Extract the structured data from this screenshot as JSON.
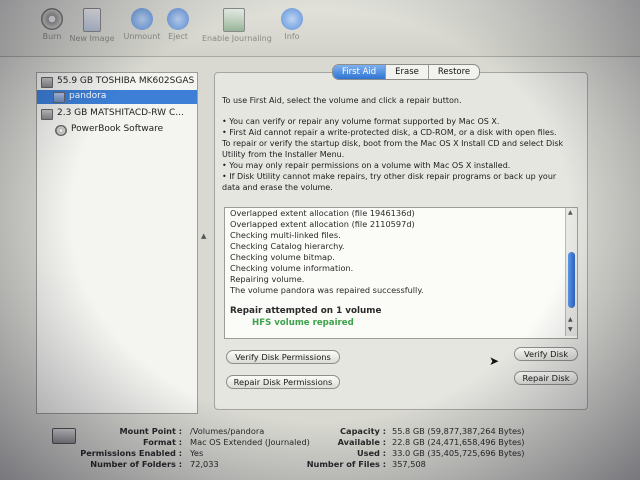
{
  "toolbar": {
    "items": [
      {
        "label": "Burn",
        "icon": "burn-icon",
        "color": "#7a7a76"
      },
      {
        "label": "New Image",
        "icon": "new-image-icon",
        "color": "#8aa0c8"
      },
      {
        "label": "Unmount",
        "icon": "unmount-icon",
        "color": "#6f9ce0"
      },
      {
        "label": "Eject",
        "icon": "eject-icon",
        "color": "#6f9ce0"
      },
      {
        "label": "Enable Journaling",
        "icon": "journaling-icon",
        "color": "#9ab89a"
      },
      {
        "label": "Info",
        "icon": "info-icon",
        "color": "#6f9ce0"
      }
    ]
  },
  "sidebar": {
    "items": [
      {
        "label": "55.9 GB TOSHIBA MK602SGAS",
        "icon": "hard-drive-icon",
        "selected": false
      },
      {
        "label": "pandora",
        "icon": "volume-icon",
        "selected": true
      },
      {
        "label": "2.3 GB MATSHITACD-RW  C...",
        "icon": "optical-drive-icon",
        "selected": false
      },
      {
        "label": "PowerBook Software",
        "icon": "disc-volume-icon",
        "selected": false
      }
    ]
  },
  "tabs": [
    "First Aid",
    "Erase",
    "Restore"
  ],
  "first_aid": {
    "intro": "To use First Aid, select the volume and click a repair button.",
    "bullets": [
      "• You can verify or repair any volume format supported by Mac OS X.",
      "• First Aid cannot repair a write-protected disk, a CD-ROM, or a disk with open files.",
      "To repair or verify the startup disk, boot from the Mac OS X Install CD and select Disk",
      "Utility from the Installer Menu.",
      "• You may only repair permissions on a volume with Mac OS X installed.",
      "• If Disk Utility cannot make repairs, try other disk repair programs or back up your",
      "data and erase the volume."
    ],
    "log": [
      "Overlapped extent allocation (file 1946136d)",
      "Overlapped extent allocation (file 2110597d)",
      "Checking multi-linked files.",
      "Checking Catalog hierarchy.",
      "Checking volume bitmap.",
      "Checking volume information.",
      "Repairing volume.",
      "The volume pandora was repaired successfully."
    ],
    "result_title": "Repair attempted on 1 volume",
    "result_status": "HFS volume repaired",
    "buttons": {
      "verify_permissions": "Verify Disk Permissions",
      "repair_permissions": "Repair Disk Permissions",
      "verify_disk": "Verify Disk",
      "repair_disk": "Repair Disk"
    }
  },
  "info": {
    "left": [
      {
        "label": "Mount Point :",
        "value": "/Volumes/pandora"
      },
      {
        "label": "Format :",
        "value": "Mac OS Extended (Journaled)"
      },
      {
        "label": "Permissions Enabled :",
        "value": "Yes"
      },
      {
        "label": "Number of Folders :",
        "value": "72,033"
      }
    ],
    "right": [
      {
        "label": "Capacity :",
        "value": "55.8 GB (59,877,387,264 Bytes)"
      },
      {
        "label": "Available :",
        "value": "22.8 GB (24,471,658,496 Bytes)"
      },
      {
        "label": "Used :",
        "value": "33.0 GB (35,405,725,696 Bytes)"
      },
      {
        "label": "Number of Files :",
        "value": "357,508"
      }
    ]
  },
  "colors": {
    "selection": "#3d7fd6",
    "success": "#3ca24a"
  }
}
